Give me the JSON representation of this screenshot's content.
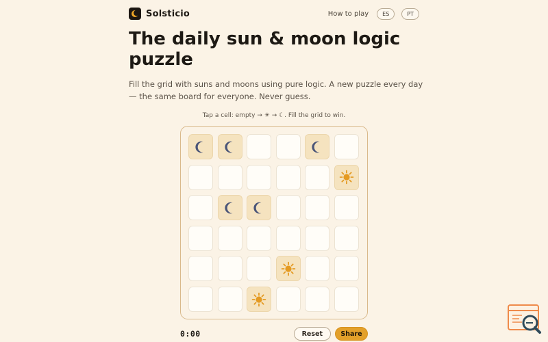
{
  "app": {
    "name": "Solsticio",
    "logo_icon": "crescent-moon-icon"
  },
  "nav": {
    "how_to_play": "How to play",
    "languages": [
      "ES",
      "PT"
    ]
  },
  "hero": {
    "title": "The daily sun & moon logic puzzle",
    "subtitle": "Fill the grid with suns and moons using pure logic. A new puzzle every day — the same board for everyone. Never guess."
  },
  "game": {
    "hint": "Tap a cell: empty → ☀ → ☾. Fill the grid to win.",
    "rows": 6,
    "cols": 6,
    "grid": [
      [
        "moon",
        "moon",
        "empty",
        "empty",
        "moon",
        "empty"
      ],
      [
        "empty",
        "empty",
        "empty",
        "empty",
        "empty",
        "sun"
      ],
      [
        "empty",
        "moon",
        "moon",
        "empty",
        "empty",
        "empty"
      ],
      [
        "empty",
        "empty",
        "empty",
        "empty",
        "empty",
        "empty"
      ],
      [
        "empty",
        "empty",
        "empty",
        "sun",
        "empty",
        "empty"
      ],
      [
        "empty",
        "empty",
        "sun",
        "empty",
        "empty",
        "empty"
      ]
    ],
    "timer": "0:00",
    "reset_label": "Reset",
    "share_label": "Share"
  },
  "colors": {
    "background": "#fbf3e6",
    "filled_cell": "#f5e3bf",
    "moon": "#4a5578",
    "sun": "#e49a22",
    "accent": "#e3a02a",
    "board_border": "#d9b98b"
  },
  "widget": {
    "icon": "search-window-icon"
  }
}
